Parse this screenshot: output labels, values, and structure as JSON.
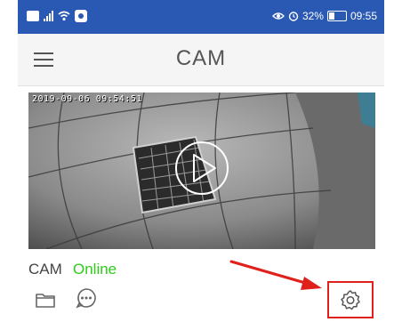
{
  "status_bar": {
    "battery_percent": "32%",
    "time": "09:55",
    "battery_level": 0.32,
    "icons": [
      "hd-icon",
      "signal-icon",
      "wifi-icon",
      "app-notification-icon",
      "eye-comfort-icon",
      "alarm-icon",
      "battery-icon"
    ]
  },
  "header": {
    "title": "CAM",
    "menu_icon": "hamburger-menu-icon"
  },
  "camera": {
    "timestamp": "2019-09-06 09:54:51",
    "name": "CAM",
    "status": "Online",
    "status_color": "#2ecc1a",
    "actions": [
      "folder-icon",
      "message-icon",
      "settings-icon"
    ]
  },
  "colors": {
    "status_bar": "#2a59b3",
    "annotation": "#e0201b"
  }
}
